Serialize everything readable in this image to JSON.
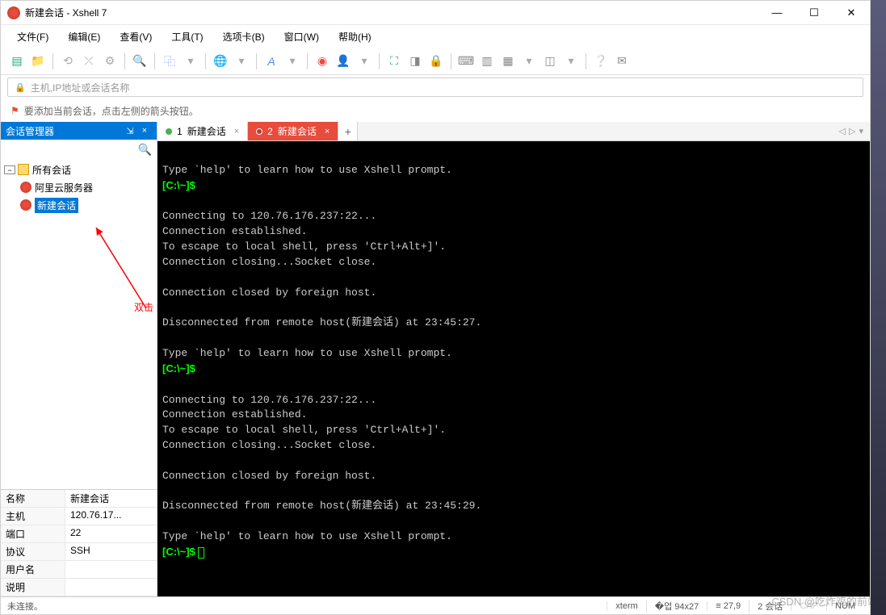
{
  "window": {
    "title": "新建会话 - Xshell 7",
    "min": "—",
    "max": "☐",
    "close": "✕"
  },
  "menu": {
    "file": "文件(F)",
    "edit": "编辑(E)",
    "view": "查看(V)",
    "tools": "工具(T)",
    "tabs": "选项卡(B)",
    "window": "窗口(W)",
    "help": "帮助(H)"
  },
  "address": {
    "placeholder": "主机,IP地址或会话名称"
  },
  "hint": {
    "text": "要添加当前会话，点击左侧的箭头按钮。"
  },
  "sidebar": {
    "title": "会话管理器",
    "pin": "⇲",
    "close": "×",
    "root": "所有会话",
    "items": [
      "阿里云服务器",
      "新建会话"
    ],
    "annotation": "双击"
  },
  "properties": {
    "rows": [
      {
        "key": "名称",
        "val": "新建会话"
      },
      {
        "key": "主机",
        "val": "120.76.17..."
      },
      {
        "key": "端口",
        "val": "22"
      },
      {
        "key": "协议",
        "val": "SSH"
      },
      {
        "key": "用户名",
        "val": ""
      },
      {
        "key": "说明",
        "val": ""
      }
    ]
  },
  "tabs": {
    "list": [
      {
        "num": "1",
        "label": "新建会话",
        "status": "green"
      },
      {
        "num": "2",
        "label": "新建会话",
        "status": "red"
      }
    ],
    "add": "+"
  },
  "terminal": {
    "lines": [
      {
        "t": "",
        "p": false
      },
      {
        "t": "Type `help' to learn how to use Xshell prompt.",
        "p": false
      },
      {
        "t": "[C:\\~]$ ",
        "p": true
      },
      {
        "t": "",
        "p": false
      },
      {
        "t": "Connecting to 120.76.176.237:22...",
        "p": false
      },
      {
        "t": "Connection established.",
        "p": false
      },
      {
        "t": "To escape to local shell, press 'Ctrl+Alt+]'.",
        "p": false
      },
      {
        "t": "Connection closing...Socket close.",
        "p": false
      },
      {
        "t": "",
        "p": false
      },
      {
        "t": "Connection closed by foreign host.",
        "p": false
      },
      {
        "t": "",
        "p": false
      },
      {
        "t": "Disconnected from remote host(新建会话) at 23:45:27.",
        "p": false
      },
      {
        "t": "",
        "p": false
      },
      {
        "t": "Type `help' to learn how to use Xshell prompt.",
        "p": false
      },
      {
        "t": "[C:\\~]$ ",
        "p": true
      },
      {
        "t": "",
        "p": false
      },
      {
        "t": "Connecting to 120.76.176.237:22...",
        "p": false
      },
      {
        "t": "Connection established.",
        "p": false
      },
      {
        "t": "To escape to local shell, press 'Ctrl+Alt+]'.",
        "p": false
      },
      {
        "t": "Connection closing...Socket close.",
        "p": false
      },
      {
        "t": "",
        "p": false
      },
      {
        "t": "Connection closed by foreign host.",
        "p": false
      },
      {
        "t": "",
        "p": false
      },
      {
        "t": "Disconnected from remote host(新建会话) at 23:45:29.",
        "p": false
      },
      {
        "t": "",
        "p": false
      },
      {
        "t": "Type `help' to learn how to use Xshell prompt.",
        "p": false
      }
    ],
    "final_prompt": "[C:\\~]$ "
  },
  "statusbar": {
    "conn": "未连接。",
    "term": "xterm",
    "size": "�업 94x27",
    "pos": "≡ 27,9",
    "sessions": "2 会话",
    "caps": "CAP",
    "num": "NUM"
  },
  "watermark": "CSDN @吃炸鸡的前端"
}
